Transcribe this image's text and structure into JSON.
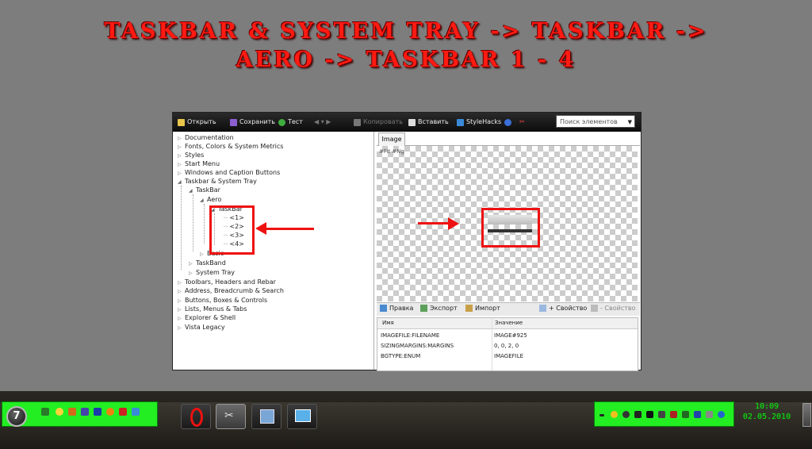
{
  "title": {
    "line1": "Taskbar & System Tray -> Taskbar ->",
    "line2": "Aero -> Taskbar 1 - 4"
  },
  "toolbar": {
    "open": "Открыть",
    "save": "Сохранить",
    "test": "Тест",
    "copy": "Копировать",
    "paste": "Вставить",
    "stylehacks": "StyleHacks",
    "search_placeholder": "Поиск элементов"
  },
  "tree": {
    "documentation": "Documentation",
    "fonts": "Fonts, Colors & System Metrics",
    "styles": "Styles",
    "start_menu": "Start Menu",
    "windows_caption": "Windows and Caption Buttons",
    "taskbar_tray": "Taskbar & System Tray",
    "taskbar": "TaskBar",
    "aero": "Aero",
    "taskbar_sub": "TaskBar",
    "item1": "<1>",
    "item2": "<2>",
    "item3": "<3>",
    "item4": "<4>",
    "basic": "Basic",
    "taskband": "TaskBand",
    "system_tray": "System Tray",
    "toolbars": "Toolbars, Headers and Rebar",
    "address": "Address, Breadcrumb & Search",
    "buttons": "Buttons, Boxes & Controls",
    "lists": "Lists, Menus & Tabs",
    "explorer": "Explorer & Shell",
    "vista": "Vista Legacy"
  },
  "image_panel": {
    "tab": "Image",
    "canvas_label": "#Fit #Ng"
  },
  "props_toolbar": {
    "edit": "Правка",
    "export": "Экспорт",
    "import": "Импорт",
    "add_prop": "+ Свойство",
    "remove_prop": "- Свойство"
  },
  "props": {
    "col_name": "Имя",
    "col_value": "Значение",
    "rows": [
      {
        "name": "IMAGEFILE:FILENAME",
        "value": "IMAGE#925"
      },
      {
        "name": "SIZINGMARGINS:MARGINS",
        "value": "0, 0, 2, 0"
      },
      {
        "name": "BGTYPE:ENUM",
        "value": "IMAGEFILE"
      }
    ]
  },
  "taskbar": {
    "start_label": "7",
    "clock_time": "10:09",
    "clock_date": "02.05.2010"
  },
  "colors": {
    "highlight": "#e11111",
    "tray_green": "#22ee22"
  }
}
